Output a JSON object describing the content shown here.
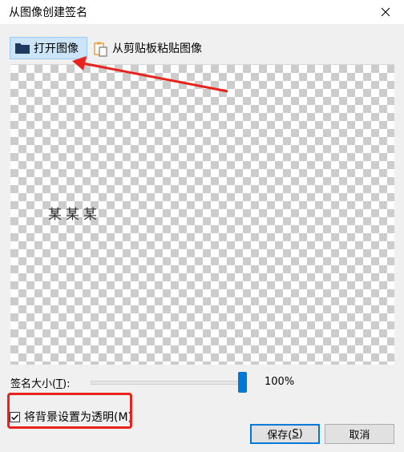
{
  "window": {
    "title": "从图像创建签名"
  },
  "toolbar": {
    "open_image_label": "打开图像",
    "paste_label": "从剪贴板粘贴图像"
  },
  "preview": {
    "signature_text": "某某某"
  },
  "signature_size": {
    "label_prefix": "签名大小(",
    "label_accel": "T",
    "label_suffix": "):",
    "value_percent": 100,
    "value_text": "100%"
  },
  "transparent_background": {
    "label": "将背景设置为透明(M)",
    "checked": true
  },
  "buttons": {
    "save_prefix": "保存(",
    "save_accel": "S",
    "save_suffix": ")",
    "cancel_label": "取消"
  },
  "colors": {
    "accent": "#0078d7",
    "annotation": "#e8221c",
    "selected_tool_bg": "#cce4f7"
  },
  "icons": {
    "open": "folder-icon",
    "paste": "clipboard-icon",
    "close": "close-icon",
    "check": "checkmark-icon"
  }
}
